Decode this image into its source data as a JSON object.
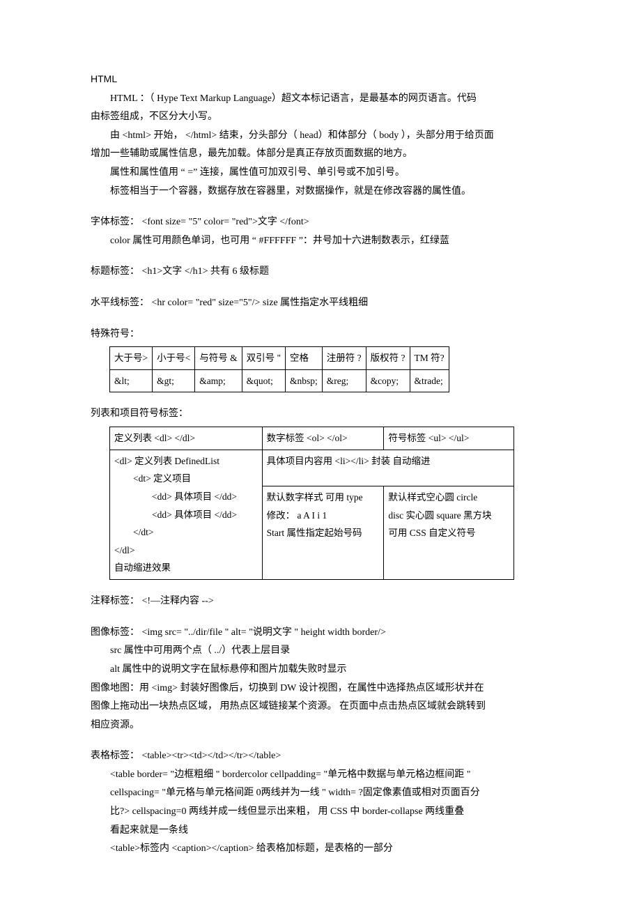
{
  "heading": "HTML",
  "p1": "HTML ：（ Hype Text Markup Language）超文本标记语言，是最基本的网页语言。代码",
  "p1b": "由标签组成，不区分大小写。",
  "p2": "由 <html> 开始，  </html> 结束，分头部分（  head）和体部分（  body ），头部分用于给页面",
  "p2b": "增加一些辅助或属性信息，最先加载。体部分是真正存放页面数据的地方。",
  "p3": "属性和属性值用 “  =” 连接，属性值可加双引号、单引号或不加引号。",
  "p4": "标签相当于一个容器，数据存放在容器里，对数据操作，就是在修改容器的属性值。",
  "font1": "字体标签：  <font size= \"5\" color= \"red\">文字 </font>",
  "font2": "color 属性可用颜色单词，也可用 “   #FFFFFF ”：井号加十六进制数表示，红绿蓝",
  "header1": "标题标签：  <h1>文字 </h1>   共有 6 级标题",
  "hr1": "水平线标签：  <hr color= \"red\" size=\"5\"/>   size 属性指定水平线粗细",
  "sym_title": "特殊符号：",
  "sym": {
    "h": [
      "大于号>",
      "小于号<",
      "与符号 &",
      "双引号 \"",
      "空格",
      "注册符 ?",
      "版权符 ?",
      "TM 符?"
    ],
    "v": [
      "&lt;",
      "&gt;",
      "&amp;",
      "&quot;",
      "&nbsp;",
      "&reg;",
      "&copy;",
      "&trade;"
    ]
  },
  "list_title": "列表和项目符号标签：",
  "tbl2": {
    "r1c1": "定义列表 <dl> </dl>",
    "r1c2": "数字标签 <ol> </ol>",
    "r1c3": "符号标签 <ul> </ul>",
    "r2c1_l1": "<dl> 定义列表  DefinedList",
    "r2c1_l2": "<dt> 定义项目",
    "r2c1_l3": "<dd> 具体项目  </dd>",
    "r2c1_l4": "<dd> 具体项目  </dd>",
    "r2c1_l5": "</dt>",
    "r2c1_l6": "</dl>",
    "r2c1_l7": "自动缩进效果",
    "r2c2": "具体项目内容用  <li></li> 封装   自动缩进",
    "r3c2_l1": "默认数字样式   可用 type",
    "r3c2_l2": "修改： a  A  I  i  1",
    "r3c2_l3": "Start 属性指定起始号码",
    "r3c3_l1": "默认样式空心圆   circle",
    "r3c3_l2": "disc 实心圆   square 黑方块",
    "r3c3_l3": "可用 CSS 自定义符号"
  },
  "comment": "注释标签：  <!—注释内容  -->",
  "img1": "图像标签：  <img src= \"../dir/file \" alt= \"说明文字  \" height   width   border/>",
  "img2": "src 属性中可用两个点（  ../）代表上层目录",
  "img3": "alt 属性中的说明文字在鼠标悬停和图片加载失败时显示",
  "img4": "图像地图：用 <img> 封装好图像后，切换到   DW 设计视图，在属性中选择热点区域形状并在",
  "img5": "图像上拖动出一块热点区域，  用热点区域链接某个资源。  在页面中点击热点区域就会跳转到",
  "img6": "相应资源。",
  "t1": "表格标签：  <table><tr><td></td></tr></table>",
  "t2": "<table border= \"边框粗细 \"  bordercolor   cellpadding= \"单元格中数据与单元格边框间距   \"",
  "t3": "cellspacing= \"单元格与单元格间距   0两线并为一线  \" width= ?固定像素值或相对页面百分",
  "t4": "比?>    cellspacing=0 两线并成一线但显示出来粗，  用 CSS 中 border-collapse 两线重叠",
  "t5": "看起来就是一条线",
  "t6": "<table>标签内 <caption></caption> 给表格加标题，是表格的一部分"
}
